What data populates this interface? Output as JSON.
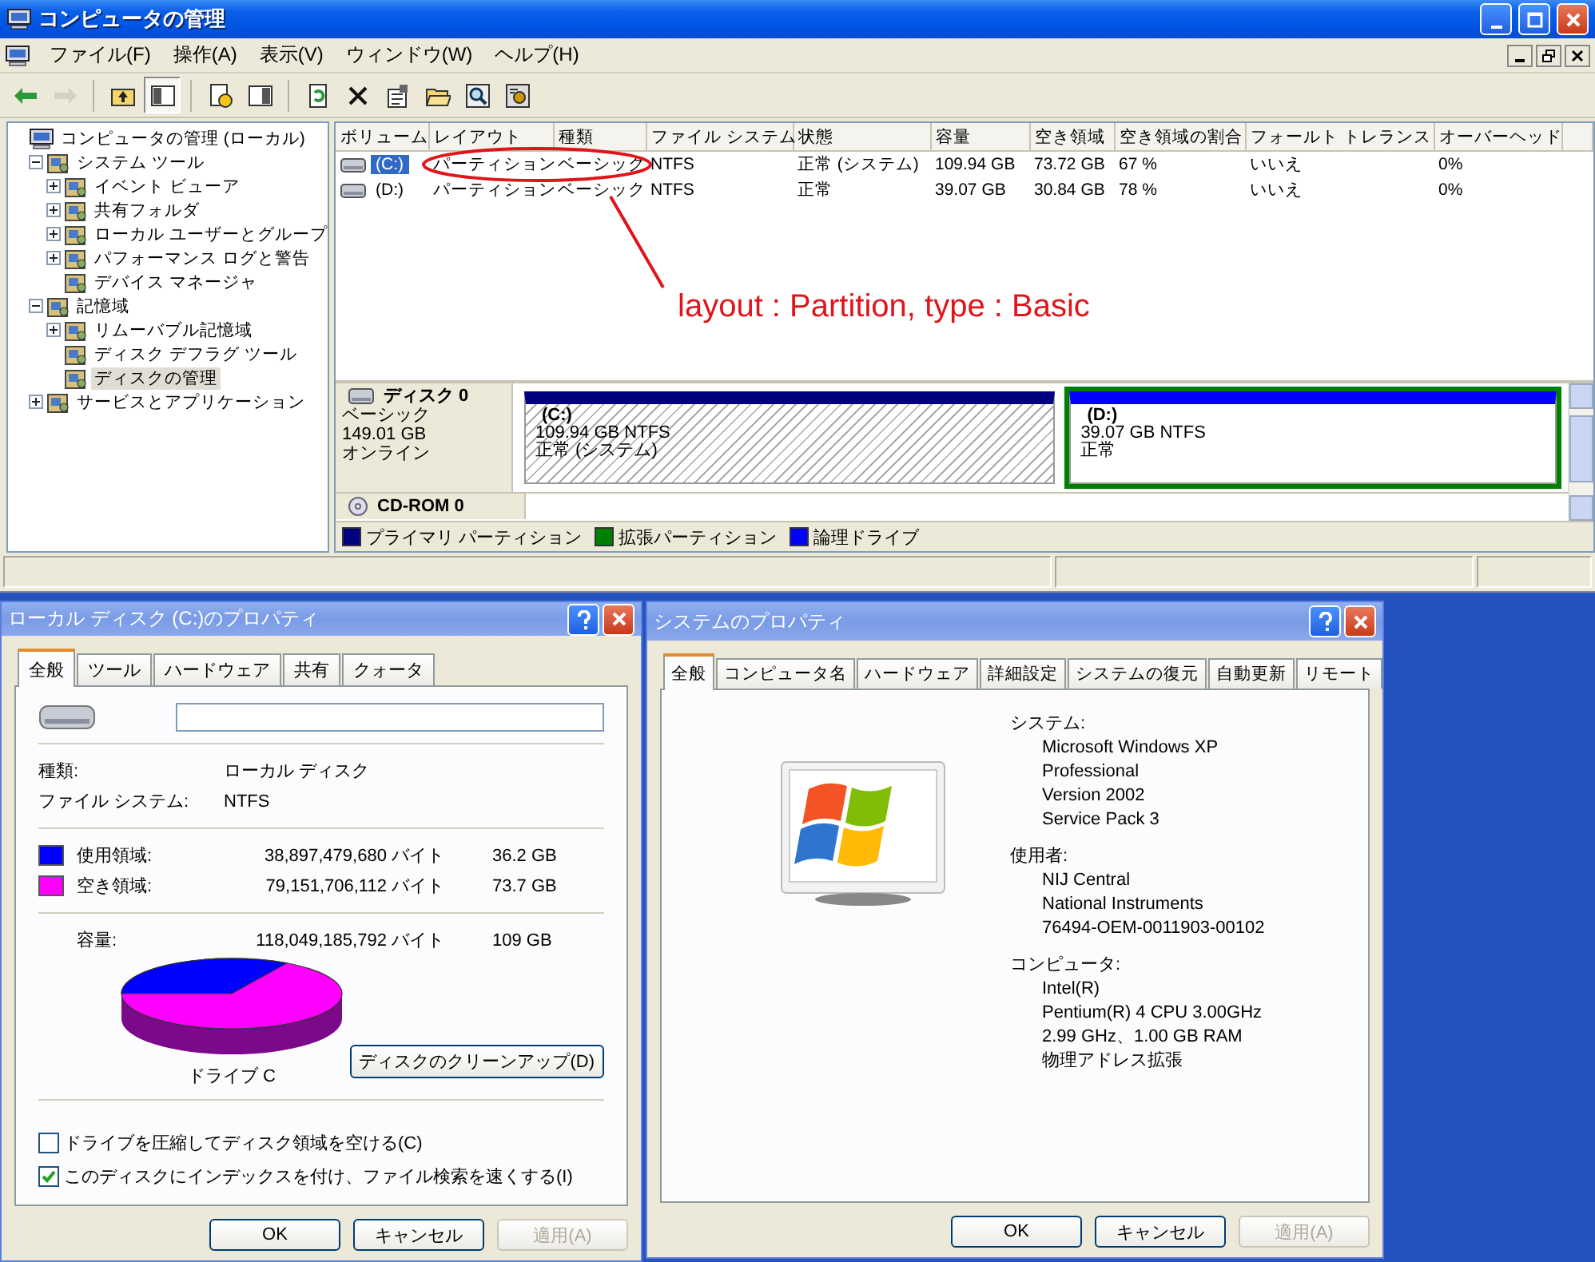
{
  "main_window": {
    "title": "コンピュータの管理",
    "menu": [
      "ファイル(F)",
      "操作(A)",
      "表示(V)",
      "ウィンドウ(W)",
      "ヘルプ(H)"
    ],
    "toolbar": [
      {
        "kind": "back",
        "disabled": false,
        "pressed": false
      },
      {
        "kind": "forward",
        "disabled": true,
        "pressed": false
      },
      {
        "kind": "separator"
      },
      {
        "kind": "up",
        "disabled": false,
        "pressed": false
      },
      {
        "kind": "tree",
        "disabled": false,
        "pressed": true
      },
      {
        "kind": "separator"
      },
      {
        "kind": "help",
        "disabled": false,
        "pressed": false
      },
      {
        "kind": "pane",
        "disabled": false,
        "pressed": false
      },
      {
        "kind": "separator"
      },
      {
        "kind": "refresh",
        "disabled": false,
        "pressed": false
      },
      {
        "kind": "delete",
        "disabled": false,
        "pressed": false
      },
      {
        "kind": "properties",
        "disabled": false,
        "pressed": false
      },
      {
        "kind": "open",
        "disabled": false,
        "pressed": false
      },
      {
        "kind": "search",
        "disabled": false,
        "pressed": false
      },
      {
        "kind": "settings",
        "disabled": false,
        "pressed": false
      }
    ],
    "tree": [
      {
        "label": "コンピュータの管理 (ローカル)",
        "kind": "root",
        "selected": false,
        "children": [
          {
            "label": "システム ツール",
            "kind": "branch",
            "expanded": true,
            "selected": false,
            "children": [
              {
                "label": "イベント ビューア",
                "kind": "branch",
                "expanded": false,
                "selected": false
              },
              {
                "label": "共有フォルダ",
                "kind": "branch",
                "expanded": false,
                "selected": false
              },
              {
                "label": "ローカル ユーザーとグループ",
                "kind": "branch",
                "expanded": false,
                "selected": false
              },
              {
                "label": "パフォーマンス ログと警告",
                "kind": "branch",
                "expanded": false,
                "selected": false
              },
              {
                "label": "デバイス マネージャ",
                "kind": "leaf",
                "selected": false
              }
            ]
          },
          {
            "label": "記憶域",
            "kind": "branch",
            "expanded": true,
            "selected": false,
            "children": [
              {
                "label": "リムーバブル記憶域",
                "kind": "branch",
                "expanded": false,
                "selected": false
              },
              {
                "label": "ディスク デフラグ ツール",
                "kind": "leaf",
                "selected": false
              },
              {
                "label": "ディスクの管理",
                "kind": "leaf",
                "selected": true
              }
            ]
          },
          {
            "label": "サービスとアプリケーション",
            "kind": "branch",
            "expanded": false,
            "selected": false
          }
        ]
      }
    ],
    "volume_table": {
      "columns": [
        "ボリューム",
        "レイアウト",
        "種類",
        "ファイル システム",
        "状態",
        "容量",
        "空き領域",
        "空き領域の割合",
        "フォールト トレランス",
        "オーバーヘッド"
      ],
      "rows": [
        {
          "selected": true,
          "cells": [
            "(C:)",
            "パーティション",
            "ベーシック",
            "NTFS",
            "正常 (システム)",
            "109.94 GB",
            "73.72 GB",
            "67 %",
            "いいえ",
            "0%"
          ]
        },
        {
          "selected": false,
          "cells": [
            "(D:)",
            "パーティション",
            "ベーシック",
            "NTFS",
            "正常",
            "39.07 GB",
            "30.84 GB",
            "78 %",
            "いいえ",
            "0%"
          ]
        }
      ]
    },
    "annotation": {
      "text": "layout : Partition, type : Basic"
    },
    "disks": [
      {
        "kind": "disk",
        "name": "ディスク 0",
        "details": [
          "ベーシック",
          "149.01 GB",
          "オンライン"
        ],
        "partitions": [
          {
            "kind": "primary",
            "selected": true,
            "label": "(C:)",
            "size": "109.94 GB NTFS",
            "status": "正常 (システム)"
          },
          {
            "kind": "logical",
            "selected": false,
            "label": "(D:)",
            "size": "39.07 GB NTFS",
            "status": "正常"
          }
        ]
      },
      {
        "kind": "cdrom",
        "name": "CD-ROM 0"
      }
    ],
    "legend": [
      {
        "label": "プライマリ パーティション",
        "color": "#000080"
      },
      {
        "label": "拡張パーティション",
        "color": "#008000"
      },
      {
        "label": "論理ドライブ",
        "color": "#0000ff"
      }
    ]
  },
  "disk_properties": {
    "title": "ローカル ディスク (C:)のプロパティ",
    "tabs": [
      {
        "label": "全般",
        "selected": true
      },
      {
        "label": "ツール",
        "selected": false
      },
      {
        "label": "ハードウェア",
        "selected": false
      },
      {
        "label": "共有",
        "selected": false
      },
      {
        "label": "クォータ",
        "selected": false
      }
    ],
    "fields": [
      {
        "label": "種類:",
        "value": "ローカル ディスク"
      },
      {
        "label": "ファイル システム:",
        "value": "NTFS"
      }
    ],
    "usage": [
      {
        "label": "使用領域:",
        "bytes": "38,897,479,680 バイト",
        "size": "36.2 GB",
        "color": "#0000ff"
      },
      {
        "label": "空き領域:",
        "bytes": "79,151,706,112 バイト",
        "size": "73.7 GB",
        "color": "#ff00ff"
      }
    ],
    "capacity": {
      "label": "容量:",
      "bytes": "118,049,185,792 バイト",
      "size": "109 GB"
    },
    "drive_label": "ドライブ C",
    "cleanup_button": "ディスクのクリーンアップ(D)",
    "options": [
      {
        "label": "ドライブを圧縮してディスク領域を空ける(C)",
        "checked": false
      },
      {
        "label": "このディスクにインデックスを付け、ファイル検索を速くする(I)",
        "checked": true
      }
    ],
    "buttons": [
      {
        "label": "OK",
        "disabled": false
      },
      {
        "label": "キャンセル",
        "disabled": false
      },
      {
        "label": "適用(A)",
        "disabled": true
      }
    ]
  },
  "system_properties": {
    "title": "システムのプロパティ",
    "tabs": [
      {
        "label": "全般",
        "selected": true
      },
      {
        "label": "コンピュータ名",
        "selected": false
      },
      {
        "label": "ハードウェア",
        "selected": false
      },
      {
        "label": "詳細設定",
        "selected": false
      },
      {
        "label": "システムの復元",
        "selected": false
      },
      {
        "label": "自動更新",
        "selected": false
      },
      {
        "label": "リモート",
        "selected": false
      }
    ],
    "sections": [
      {
        "heading": "システム:",
        "lines": [
          "Microsoft Windows XP",
          "Professional",
          "Version 2002",
          "Service Pack 3"
        ]
      },
      {
        "heading": "使用者:",
        "lines": [
          "NIJ Central",
          "National Instruments",
          "76494-OEM-0011903-00102"
        ]
      },
      {
        "heading": "コンピュータ:",
        "lines": [
          "Intel(R)",
          "Pentium(R) 4 CPU 3.00GHz",
          "2.99 GHz、1.00 GB RAM",
          "物理アドレス拡張"
        ]
      }
    ],
    "buttons": [
      {
        "label": "OK",
        "disabled": false
      },
      {
        "label": "キャンセル",
        "disabled": false
      },
      {
        "label": "適用(A)",
        "disabled": true
      }
    ]
  }
}
